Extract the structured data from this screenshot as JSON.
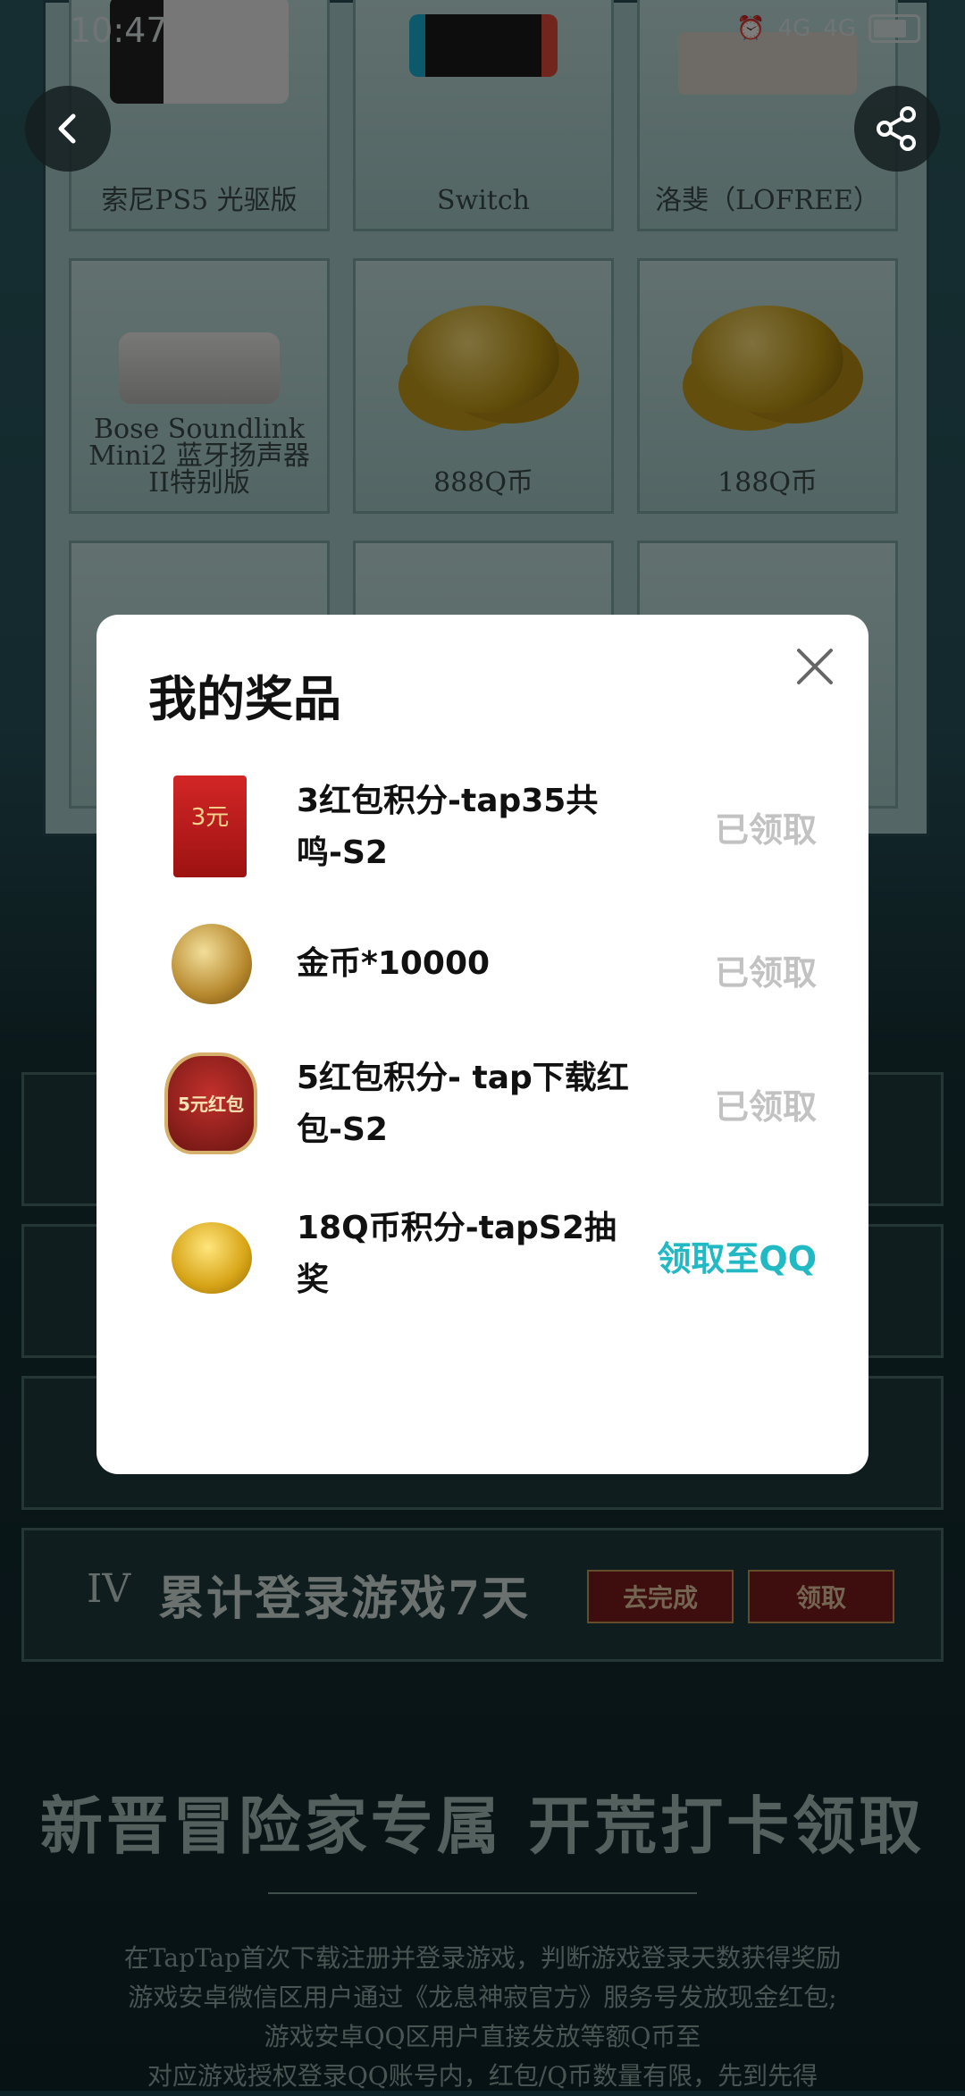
{
  "status_bar": {
    "time": "10:47",
    "signal1": "4G",
    "signal2": "4G"
  },
  "prize_grid": [
    {
      "label": "索尼PS5 光驱版",
      "icon": "console-image"
    },
    {
      "label": "Switch",
      "icon": "switch-image"
    },
    {
      "label": "洛斐（LOFREE）",
      "icon": "keyboard-image"
    },
    {
      "label": "Bose Soundlink Mini2 蓝牙扬声器II特别版",
      "icon": "speaker-image"
    },
    {
      "label": "888Q币",
      "icon": "coins-image"
    },
    {
      "label": "188Q币",
      "icon": "coins-image"
    }
  ],
  "tasks": [
    {
      "roman": "IV",
      "title": "累计登录游戏7天",
      "btn_do": "去完成",
      "btn_claim": "领取"
    }
  ],
  "section": {
    "title": "新晋冒险家专属 开荒打卡领取",
    "desc": [
      "在TapTap首次下载注册并登录游戏，判断游戏登录天数获得奖励",
      "游戏安卓微信区用户通过《龙息神寂官方》服务号发放现金红包;",
      "游戏安卓QQ区用户直接发放等额Q币至",
      "对应游戏授权登录QQ账号内，红包/Q币数量有限，先到先得"
    ]
  },
  "modal": {
    "title": "我的奖品",
    "items": [
      {
        "name": "3红包积分-tap35共鸣-S2",
        "status": "已领取",
        "claimed": true,
        "icon": "red-packet-icon",
        "icon_text": "3元"
      },
      {
        "name": "金币*10000",
        "status": "已领取",
        "claimed": true,
        "icon": "gold-coin-icon"
      },
      {
        "name": "5红包积分- tap下载红包-S2",
        "status": "已领取",
        "claimed": true,
        "icon": "red-packet-badge-icon",
        "icon_text": "5元红包"
      },
      {
        "name": "18Q币积分-tapS2抽奖",
        "status": "领取至QQ",
        "claimed": false,
        "icon": "coin-stack-icon"
      }
    ]
  },
  "colors": {
    "accent": "#20b9c4",
    "claimed": "#c2c2c2"
  }
}
